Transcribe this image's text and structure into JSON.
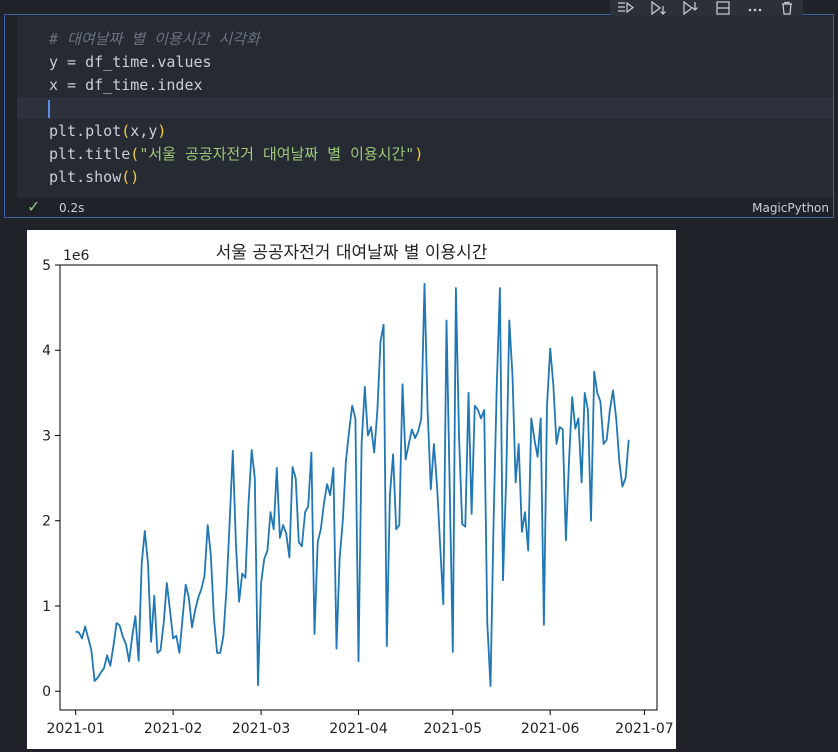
{
  "toolbar": {
    "buttons": [
      {
        "name": "execute-above-cells-button",
        "icon": "run-above-icon"
      },
      {
        "name": "execute-cell-and-below-button",
        "icon": "run-below-icon"
      },
      {
        "name": "execute-cell-button",
        "icon": "run-cell-icon"
      },
      {
        "name": "split-cell-button",
        "icon": "split-icon"
      },
      {
        "name": "more-actions-button",
        "icon": "ellipsis-icon"
      },
      {
        "name": "delete-cell-button",
        "icon": "trash-icon"
      }
    ]
  },
  "cell": {
    "code": {
      "line1": "# 대여날짜 별 이용시간 시각화",
      "line2": [
        "y",
        " = ",
        "df_time.values"
      ],
      "line3": [
        "x",
        " = ",
        "df_time.index"
      ],
      "line5": [
        "plt.plot",
        "(",
        "x,y",
        ")"
      ],
      "line6": [
        "plt.title",
        "(",
        "\"서울 공공자전거 대여날짜 별 이용시간\"",
        ")"
      ],
      "line7": [
        "plt.show",
        "(",
        ")"
      ]
    },
    "status": {
      "check": "✓",
      "time": "0.2s",
      "language": "MagicPython"
    }
  },
  "colors": {
    "line": "#1f77b4",
    "cell_border": "#3f64a6",
    "background": "#1f2229"
  },
  "chart_data": {
    "type": "line",
    "title": "서울 공공자전거 대여날짜 별 이용시간",
    "xlabel": "",
    "ylabel": "",
    "y_scale_label": "1e6",
    "ylim": [
      -0.22,
      5.0
    ],
    "xlim": [
      "2020-12-27",
      "2021-07-05"
    ],
    "x_ticks": [
      "2021-01",
      "2021-02",
      "2021-03",
      "2021-04",
      "2021-05",
      "2021-06",
      "2021-07"
    ],
    "y_ticks": [
      "0",
      "1",
      "2",
      "3",
      "4",
      "5"
    ],
    "series": [
      {
        "x_start": "2021-01-01",
        "x_step_days": 1,
        "values": [
          0.7,
          0.69,
          0.62,
          0.76,
          0.62,
          0.48,
          0.12,
          0.16,
          0.22,
          0.27,
          0.42,
          0.3,
          0.53,
          0.8,
          0.77,
          0.64,
          0.55,
          0.35,
          0.65,
          0.88,
          0.36,
          1.5,
          1.88,
          1.5,
          0.58,
          1.12,
          0.45,
          0.48,
          0.8,
          1.27,
          0.95,
          0.62,
          0.65,
          0.45,
          0.85,
          1.25,
          1.1,
          0.75,
          0.95,
          1.1,
          1.2,
          1.35,
          1.95,
          1.6,
          0.85,
          0.45,
          0.45,
          0.65,
          1.2,
          2.0,
          2.82,
          1.7,
          1.05,
          1.38,
          1.33,
          2.2,
          2.83,
          2.5,
          0.07,
          1.27,
          1.55,
          1.65,
          2.1,
          1.9,
          2.62,
          1.8,
          1.95,
          1.85,
          1.57,
          2.63,
          2.5,
          1.75,
          1.7,
          2.1,
          2.17,
          2.8,
          0.67,
          1.75,
          1.9,
          2.2,
          2.43,
          2.3,
          2.62,
          0.5,
          1.55,
          2.0,
          2.7,
          3.05,
          3.35,
          3.2,
          0.35,
          2.9,
          3.57,
          3.0,
          3.1,
          2.8,
          3.3,
          4.1,
          4.3,
          0.53,
          2.3,
          2.78,
          1.9,
          1.95,
          3.6,
          2.72,
          2.9,
          3.07,
          2.97,
          3.05,
          3.2,
          4.78,
          3.3,
          2.37,
          2.9,
          2.4,
          1.7,
          1.02,
          4.35,
          2.45,
          0.46,
          4.73,
          3.0,
          1.96,
          1.93,
          3.5,
          2.08,
          3.35,
          3.3,
          3.2,
          3.3,
          0.8,
          0.06,
          2.0,
          3.6,
          4.73,
          1.3,
          2.5,
          4.35,
          3.7,
          2.45,
          2.9,
          1.87,
          2.1,
          1.65,
          3.2,
          2.95,
          2.75,
          3.2,
          0.78,
          3.35,
          4.02,
          3.6,
          2.9,
          3.1,
          3.07,
          1.77,
          2.7,
          3.45,
          3.08,
          3.2,
          2.45,
          3.5,
          3.3,
          2.0,
          3.75,
          3.5,
          3.4,
          2.9,
          2.95,
          3.3,
          3.53,
          3.2,
          2.7,
          2.4,
          2.5,
          2.95
        ]
      }
    ],
    "grid": false,
    "legend": "none"
  }
}
